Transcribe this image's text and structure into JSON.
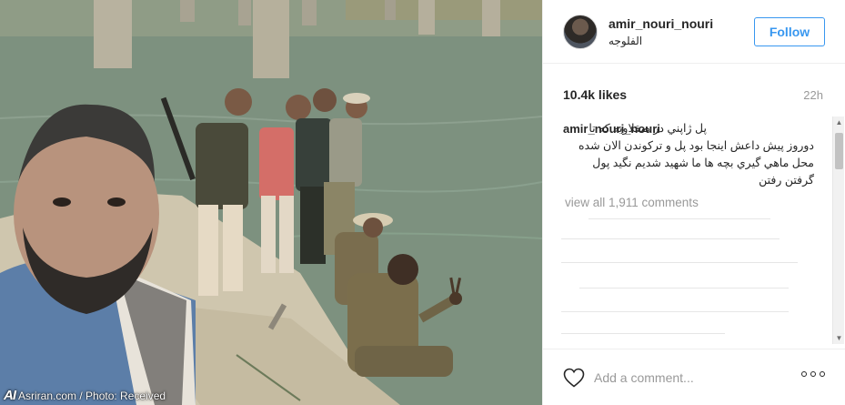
{
  "post": {
    "username": "amir_nouri_nouri",
    "location": "الفلوجه",
    "follow_label": "Follow",
    "likes": "10.4k likes",
    "time_ago": "22h",
    "caption_user": "amir_nouri_nouri",
    "caption_text": "پل ژاپني در صقلاويه كه تا دوروز پيش داعش اينجا بود پل و تركوندن الان شده محل ماهي گيري بچه ها ما شهيد شديم نگيد پول گرفتن رفتن",
    "view_all_comments": "view all 1,911 comments",
    "add_comment_placeholder": "Add a comment...",
    "icons": {
      "like": "heart-icon",
      "more": "more-options-icon",
      "scroll_up": "scroll-up-arrow-icon",
      "scroll_down": "scroll-down-arrow-icon"
    },
    "colors": {
      "accent": "#3897f0",
      "text": "#262626",
      "muted": "#999999",
      "border": "#efefef"
    }
  },
  "photo": {
    "watermark_logo": "AI",
    "watermark_text": "Asriran.com / Photo: Received"
  }
}
